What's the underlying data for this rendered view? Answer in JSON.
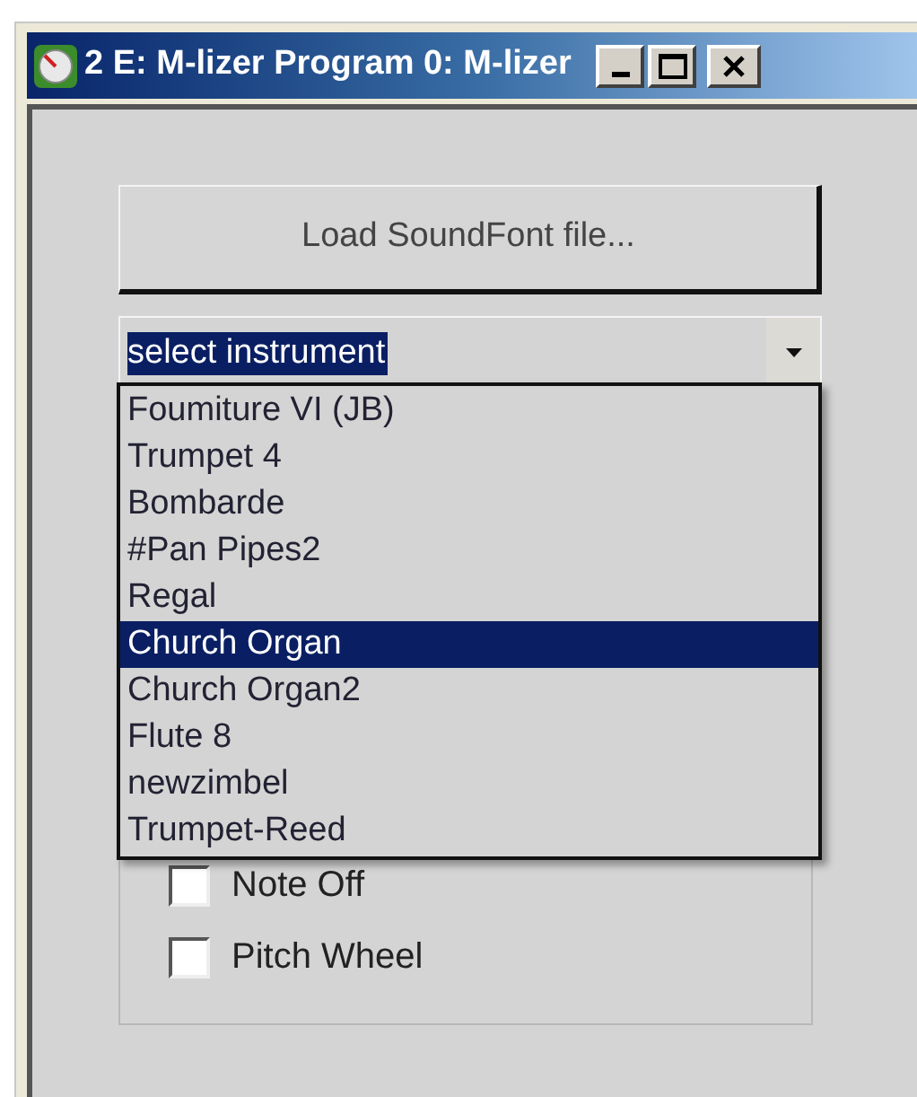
{
  "window": {
    "title": "2 E: M-lizer Program 0: M-lizer"
  },
  "load_button": "Load SoundFont file...",
  "instrument_select": {
    "value": "select instrument",
    "expanded": true
  },
  "instruments": [
    {
      "label": "Foumiture VI (JB)",
      "selected": false
    },
    {
      "label": "Trumpet 4",
      "selected": false
    },
    {
      "label": "Bombarde",
      "selected": false
    },
    {
      "label": "#Pan Pipes2",
      "selected": false
    },
    {
      "label": "Regal",
      "selected": false
    },
    {
      "label": "Church Organ",
      "selected": true
    },
    {
      "label": "Church Organ2",
      "selected": false
    },
    {
      "label": "Flute 8",
      "selected": false
    },
    {
      "label": "newzimbel",
      "selected": false
    },
    {
      "label": "Trumpet-Reed",
      "selected": false
    }
  ],
  "checkboxes": [
    {
      "label": "Note Off",
      "checked": false
    },
    {
      "label": "Pitch Wheel",
      "checked": false
    }
  ]
}
